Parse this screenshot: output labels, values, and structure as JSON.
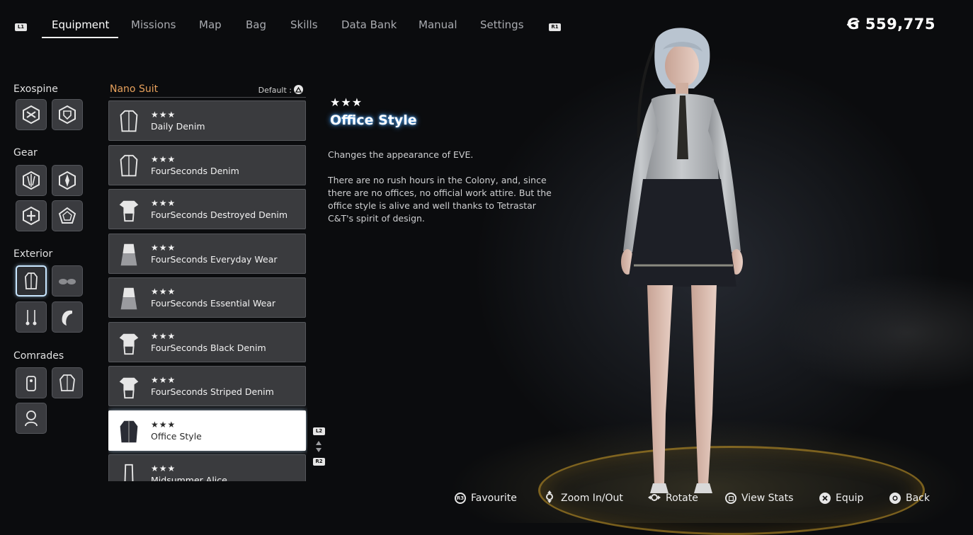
{
  "nav": {
    "left_trigger": "L1",
    "right_trigger": "R1",
    "tabs": [
      "Equipment",
      "Missions",
      "Map",
      "Bag",
      "Skills",
      "Data Bank",
      "Manual",
      "Settings"
    ],
    "active_tab": "Equipment"
  },
  "currency": {
    "symbol": "Ꞡ",
    "amount": "559,775"
  },
  "categories": {
    "exospine": "Exospine",
    "gear": "Gear",
    "exterior": "Exterior",
    "comrades": "Comrades"
  },
  "list": {
    "title": "Nano Suit",
    "default_label": "Default :",
    "items": [
      {
        "stars": "★★★",
        "name": "Daily Denim"
      },
      {
        "stars": "★★★",
        "name": "FourSeconds Denim"
      },
      {
        "stars": "★★★",
        "name": "FourSeconds Destroyed Denim"
      },
      {
        "stars": "★★★",
        "name": "FourSeconds Everyday Wear"
      },
      {
        "stars": "★★★",
        "name": "FourSeconds Essential Wear"
      },
      {
        "stars": "★★★",
        "name": "FourSeconds Black Denim"
      },
      {
        "stars": "★★★",
        "name": "FourSeconds Striped Denim"
      },
      {
        "stars": "★★★",
        "name": "Office Style"
      },
      {
        "stars": "★★★",
        "name": "Midsummer Alice"
      }
    ],
    "selected_index": 7,
    "scroll_up_tag": "L2",
    "scroll_down_tag": "R2"
  },
  "detail": {
    "stars": "★★★",
    "title": "Office Style",
    "summary": "Changes the appearance of EVE.",
    "lore": "There are no rush hours in the Colony, and, since there are no offices, no official work attire. But the office style is alive and well thanks to Tetrastar C&T's spirit of design."
  },
  "prompts": [
    {
      "icon": "R3",
      "label": "Favourite"
    },
    {
      "icon": "",
      "label": "Zoom In/Out"
    },
    {
      "icon": "",
      "label": "Rotate"
    },
    {
      "icon": "",
      "label": "View Stats"
    },
    {
      "icon": "",
      "label": "Equip"
    },
    {
      "icon": "",
      "label": "Back"
    }
  ],
  "colors": {
    "accent_orange": "#e7a15c",
    "title_glow": "#50aaff",
    "platform_gold": "#d2a028"
  }
}
